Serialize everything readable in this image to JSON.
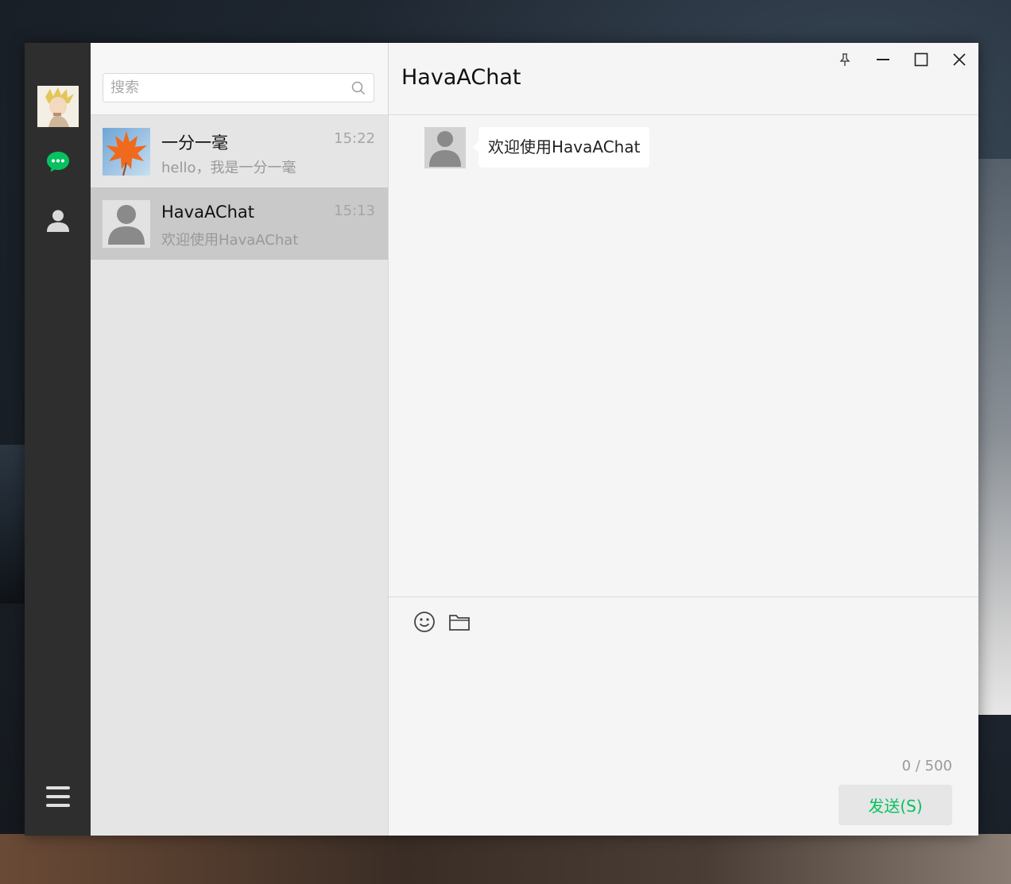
{
  "colors": {
    "accent": "#07c160",
    "nav_bg": "#2e2e2e",
    "list_bg": "#e5e5e5",
    "active_item": "#c9c9c9",
    "chat_bg": "#f5f5f5"
  },
  "sidebar": {
    "items": [
      {
        "icon": "chat-icon",
        "active": true
      },
      {
        "icon": "contacts-icon",
        "active": false
      },
      {
        "icon": "menu-icon",
        "active": false
      }
    ]
  },
  "search": {
    "placeholder": "搜索",
    "value": ""
  },
  "sessions": [
    {
      "name": "一分一毫",
      "time": "15:22",
      "last_message": "hello，我是一分一毫",
      "avatar": "maple-leaf-avatar",
      "active": false
    },
    {
      "name": "HavaAChat",
      "time": "15:13",
      "last_message": "欢迎使用HavaAChat",
      "avatar": "default-user-avatar",
      "active": true
    }
  ],
  "chat": {
    "title": "HavaAChat",
    "window_controls": [
      "pin-icon",
      "minimize-icon",
      "maximize-icon",
      "close-icon"
    ],
    "messages": [
      {
        "sender": "HavaAChat",
        "text": "欢迎使用HavaAChat",
        "avatar": "default-user-avatar"
      }
    ],
    "input": {
      "tools": [
        "emoji-icon",
        "folder-icon"
      ],
      "counter": "0 / 500",
      "send_label": "发送(S)"
    }
  }
}
